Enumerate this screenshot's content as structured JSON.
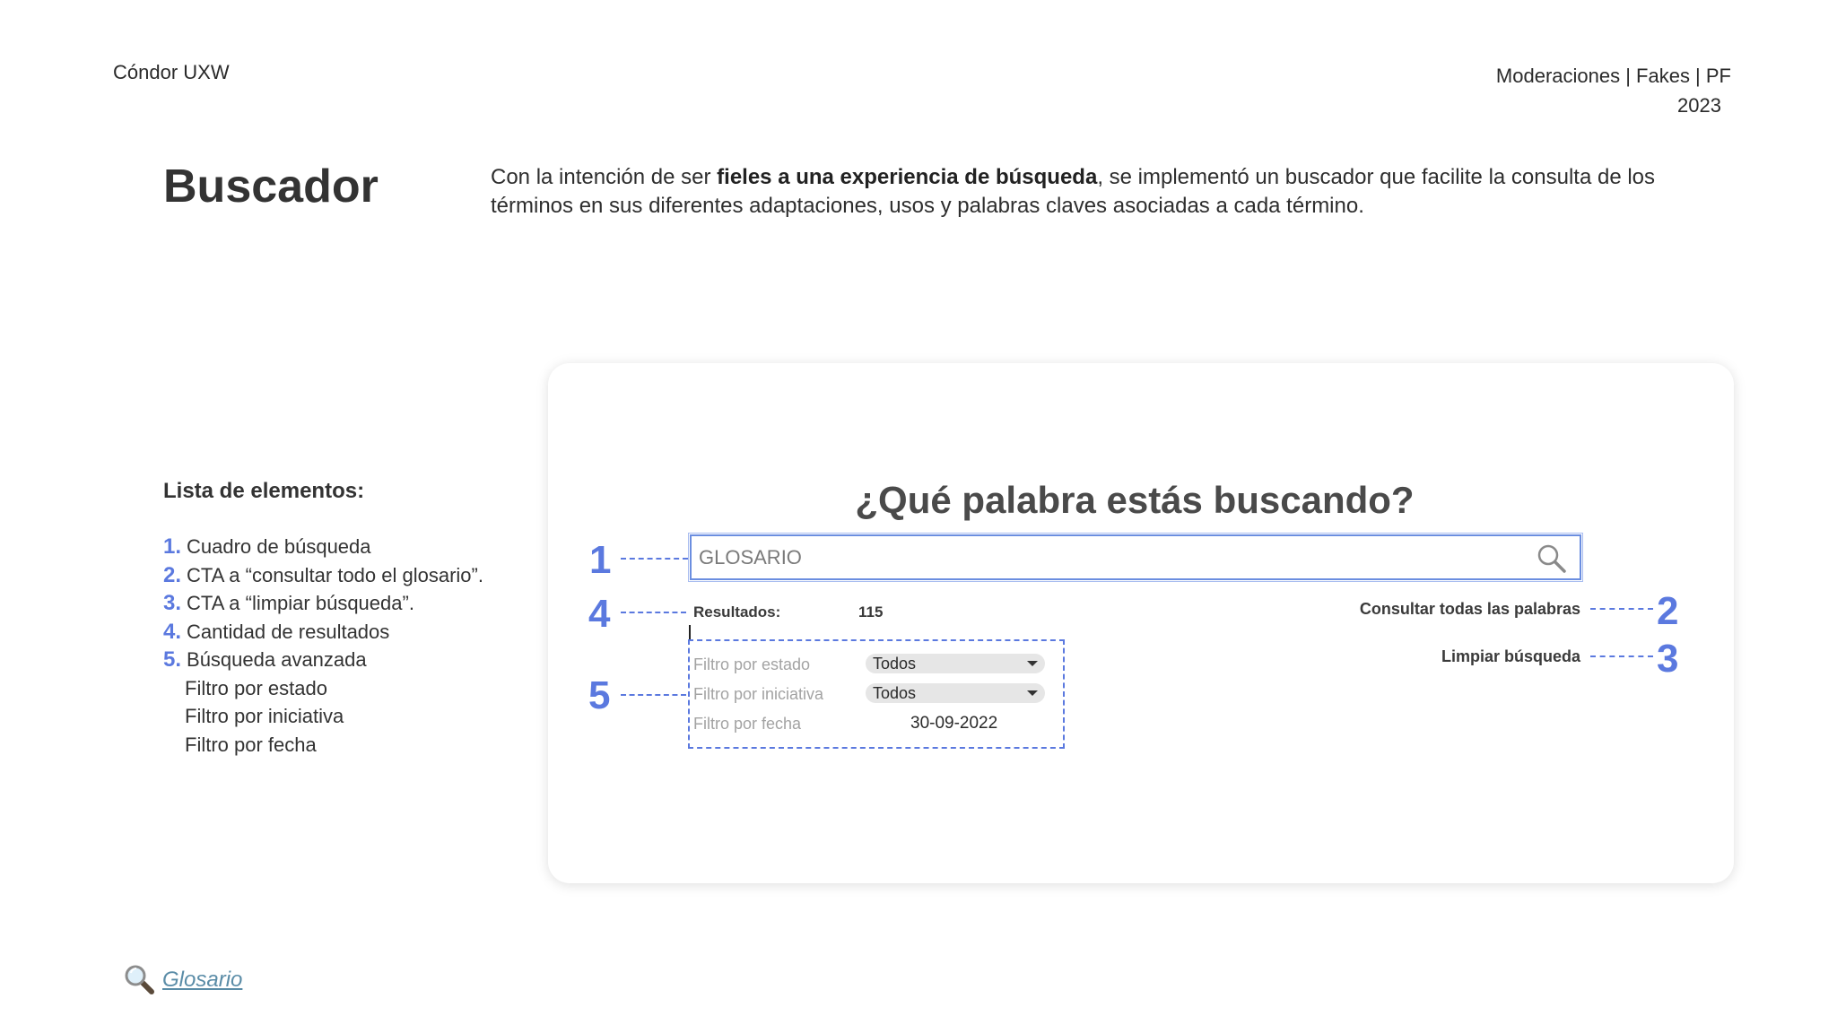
{
  "header": {
    "brand": "Cóndor UXW",
    "meta_line1": "Moderaciones | Fakes | PF",
    "meta_line2": "2023"
  },
  "section": {
    "title": "Buscador",
    "intro_pre": "Con la intención de ser ",
    "intro_bold": "fieles a una experiencia de búsqueda",
    "intro_post": ", se implementó un buscador que facilite la consulta de los términos en sus diferentes adaptaciones, usos y palabras claves asociadas a cada término."
  },
  "elements_list": {
    "title": "Lista de elementos:",
    "items": [
      {
        "num": "1.",
        "label": "Cuadro de búsqueda"
      },
      {
        "num": "2.",
        "label": "CTA a “consultar todo el glosario”."
      },
      {
        "num": "3.",
        "label": "CTA a “limpiar búsqueda”."
      },
      {
        "num": "4.",
        "label": "Cantidad de resultados"
      },
      {
        "num": "5.",
        "label": "Búsqueda avanzada"
      }
    ],
    "subitems": [
      "Filtro por estado",
      "Filtro por iniciativa",
      "Filtro por fecha"
    ]
  },
  "mockup": {
    "heading": "¿Qué palabra estás buscando?",
    "search_placeholder": "GLOSARIO",
    "results_label": "Resultados:",
    "results_count": "115",
    "consult_all": "Consultar todas las palabras",
    "clear_search": "Limpiar búsqueda",
    "filters": {
      "state_label": "Filtro por estado",
      "state_value": "Todos",
      "initiative_label": "Filtro por iniciativa",
      "initiative_value": "Todos",
      "date_label": "Filtro por fecha",
      "date_value": "30-09-2022"
    },
    "callouts": [
      "1",
      "2",
      "3",
      "4",
      "5"
    ],
    "accent_color": "#5b79df"
  },
  "footer": {
    "link_label": "Glosario",
    "icon": "magnifier-icon"
  }
}
